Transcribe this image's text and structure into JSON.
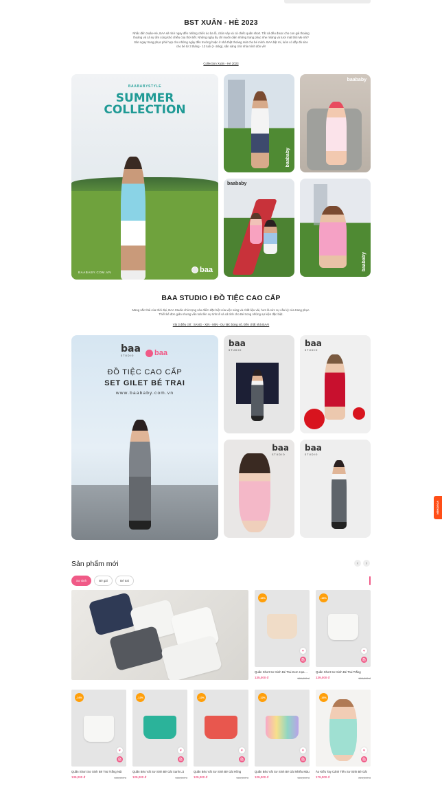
{
  "collection": {
    "title": "BST XUÂN - HÈ 2023",
    "description": "Nhắc đến Xuân-Hè, BAA sẽ nhớ ngay đến những chiếc áo ba lỗ, chân váy và cả chiếc quần short. Tất cả đều được cho con gái thoáng thoáng và cả sự ấm cúng khó chiều của thời tiết. Những ngày ấy chỉ muốn diện những trang phục nhẹ nhàng và tươi mát thôi Mẹ nhỉ? Săn ngay trang phục phù hợp cho những ngày đến trường hoặc ở nhà thật thoáng mát cho bé mình. BAA bật mí, luôn có đầy đủ size cho bé từ 3 tháng - 13 tuổi (> 44kg), sẵn sàng chờ nhà mình đón về!",
    "link": "Collection Xuân - Hè 2023",
    "hero_kicker": "BAABABYSTYLE",
    "hero_title_1": "SUMMER",
    "hero_title_2": "COLLECTION",
    "hero_footer": "BAABABY.COM.VN",
    "brand": "baababy",
    "baa": "baa"
  },
  "studio": {
    "title": "BAA STUDIO I ĐỒ TIỆC CAO CẤP",
    "description": "Mang sắc thái của thời đại, BAA Studio chủ trọng vào điểm đặc biệt của việc sáng và chất liệu vải, hơn là sức sự cầu kỳ của trang phục. Thiết kế đơn giản nhưng vẫn toát lên sự tinh tế và cả tính cho Bé trong những sự kiện đặc biệt.",
    "link": "Vài 3 điều chỉ : SANG - XỊN - MỊN - Dự tiệc bùng nổ, Đến chất nhà BAA!",
    "hero_logo": "baa",
    "hero_logo_sub": "STUDIO",
    "hero_logo_2": "baa",
    "hero_line1": "ĐỒ TIỆC CAO CẤP",
    "hero_line2": "SET GILET BÉ TRAI",
    "hero_web": "www.baababy.com.vn"
  },
  "side_tab": "VOUCHER",
  "new_products": {
    "title": "Sản phẩm mới",
    "prev_icon": "‹",
    "next_icon": "›",
    "tabs": [
      "Sơ sinh",
      "Bé gái",
      "Bé trai"
    ],
    "items": [
      {
        "badge": "-16%",
        "name": "Quần Short Sơ Sinh Bé Trai Kem Họa Tiết",
        "price": "135,000 đ",
        "old": "160,000 đ"
      },
      {
        "badge": "-16%",
        "name": "Quần Short Sơ Sinh Bé Trai Trắng",
        "price": "139,000 đ",
        "old": "165,000 đ"
      },
      {
        "badge": "-16%",
        "name": "Quần Short Sơ Sinh Bé Trai Trắng Nút",
        "price": "139,000 đ",
        "old": "165,000 đ"
      },
      {
        "badge": "-12%",
        "name": "Quần Bèo Vải Sơ Sinh Bé Gái Xanh Lá",
        "price": "129,000 đ",
        "old": "146,000 đ"
      },
      {
        "badge": "-12%",
        "name": "Quần Bèo Vải Sơ Sinh Bé Gái Hồng",
        "price": "129,000 đ",
        "old": "146,000 đ"
      },
      {
        "badge": "-12%",
        "name": "Quần Bèo Vải Sơ Sinh Bé Gái Nhiều Màu",
        "price": "129,000 đ",
        "old": "146,000 đ"
      },
      {
        "badge": "-16%",
        "name": "Áo Kiểu Tay Cánh Tiên Sơ Sinh Bé Gái",
        "price": "179,000 đ",
        "old": "215,000 đ"
      }
    ],
    "heart_icon": "♥",
    "cart_icon": "🛍"
  }
}
